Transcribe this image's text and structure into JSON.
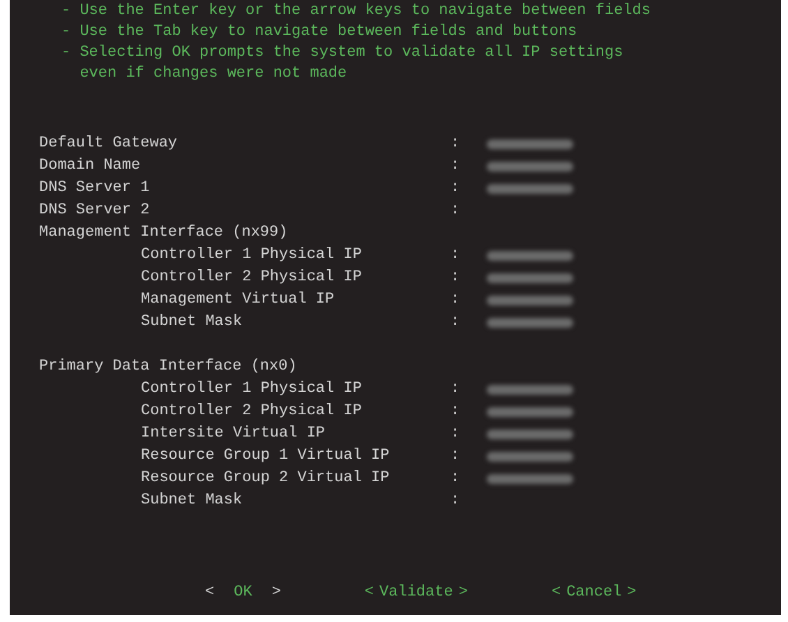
{
  "notes": [
    "- Use the Enter key or the arrow keys to navigate between fields",
    "- Use the Tab key to navigate between fields and buttons",
    "- Selecting OK prompts the system to validate all IP settings",
    "  even if changes were not made"
  ],
  "fields": [
    {
      "label": "Default Gateway",
      "redacted": true
    },
    {
      "label": "Domain Name",
      "redacted": true
    },
    {
      "label": "DNS Server 1",
      "redacted": true
    },
    {
      "label": "DNS Server 2",
      "redacted": false
    }
  ],
  "sections": [
    {
      "title": "Management Interface (nx99)",
      "children": [
        {
          "label": "Controller 1 Physical IP",
          "redacted": true
        },
        {
          "label": "Controller 2 Physical IP",
          "redacted": true
        },
        {
          "label": "Management Virtual IP",
          "redacted": true
        },
        {
          "label": "Subnet Mask",
          "redacted": true
        }
      ]
    },
    {
      "title": "Primary Data Interface (nx0)",
      "children": [
        {
          "label": "Controller 1 Physical IP",
          "redacted": true
        },
        {
          "label": "Controller 2 Physical IP",
          "redacted": true
        },
        {
          "label": "Intersite Virtual IP",
          "redacted": true
        },
        {
          "label": "Resource Group 1 Virtual IP",
          "redacted": true
        },
        {
          "label": "Resource Group 2 Virtual IP",
          "redacted": true
        },
        {
          "label": "Subnet Mask",
          "redacted": false
        }
      ]
    }
  ],
  "colon": ":",
  "buttons": [
    {
      "open": "<",
      "label": "OK",
      "close": ">",
      "selected": true
    },
    {
      "open": "<",
      "label": "Validate",
      "close": ">",
      "selected": false
    },
    {
      "open": "<",
      "label": "Cancel",
      "close": ">",
      "selected": false
    }
  ]
}
